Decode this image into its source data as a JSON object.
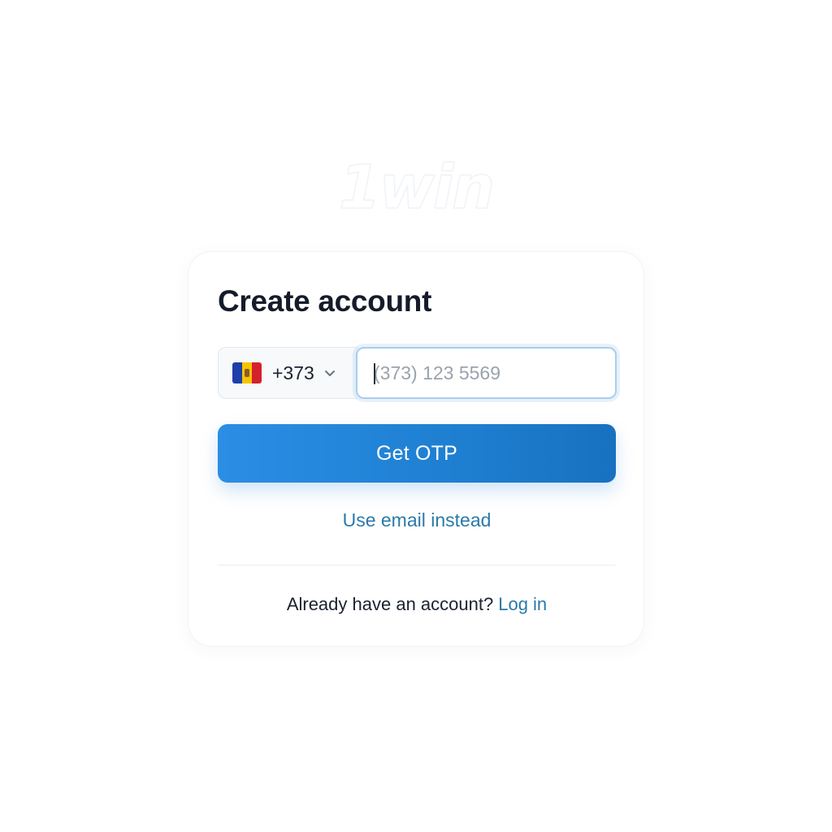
{
  "logo": {
    "text": "1win"
  },
  "form": {
    "title": "Create account",
    "country": {
      "flag_icon": "moldova-flag-icon",
      "dial_code": "+373",
      "dropdown_icon": "chevron-down-icon"
    },
    "phone": {
      "placeholder": "(373) 123 5569",
      "value": ""
    },
    "submit_label": "Get OTP",
    "alt_method_label": "Use email instead",
    "login_prompt": "Already have an account?",
    "login_link": "Log in"
  },
  "colors": {
    "primary": "#2287dd",
    "link": "#2a7aa9",
    "title": "#141c2b",
    "input_focus_border": "#a9cdf0"
  }
}
